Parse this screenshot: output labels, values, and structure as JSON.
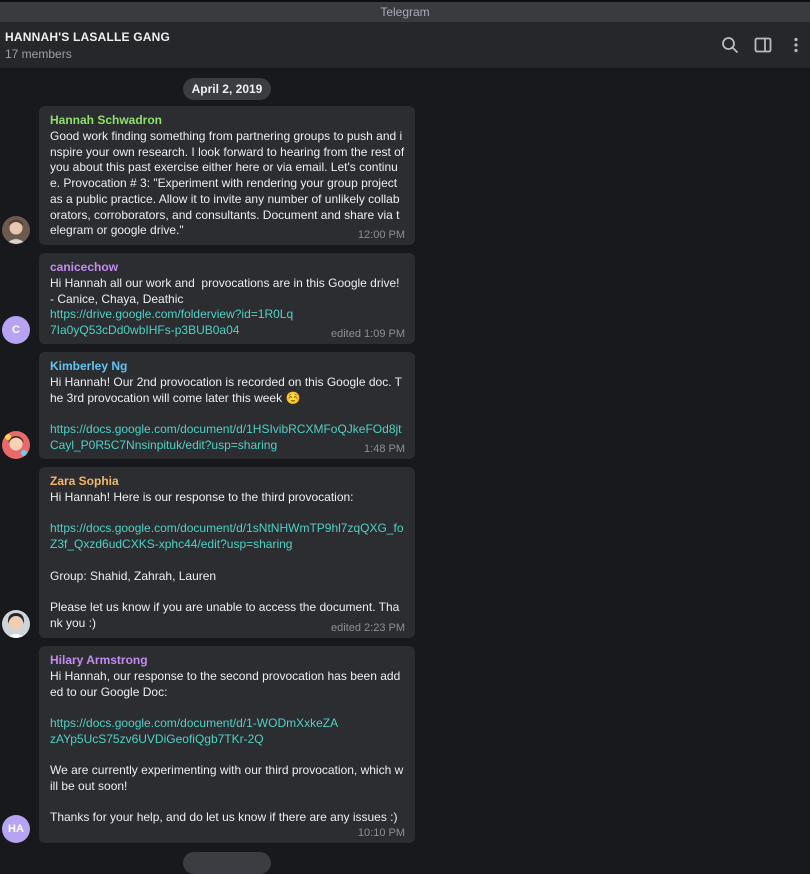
{
  "window": {
    "title": "Telegram"
  },
  "header": {
    "group_name": "HANNAH'S LASALLE GANG",
    "members": "17 members",
    "icons": [
      "search-icon",
      "sidebar-toggle-icon",
      "more-vertical-icon"
    ]
  },
  "chat": {
    "date_label": "April 2, 2019",
    "messages": [
      {
        "sender": "Hannah Schwadron",
        "sender_color": "#8fe06b",
        "text": "Good work finding something from partnering groups to push and inspire your own research. I look forward to hearing from the rest of you about this past exercise either here or via email. Let's continue. Provocation # 3: \"Experiment with rendering your group project as a public practice. Allow it to invite any number of unlikely collaborators, corroborators, and consultants. Document and share via telegram or google drive.\"",
        "time": "12:00 PM",
        "avatar": "photo"
      },
      {
        "sender": "canicechow",
        "sender_color": "#c38cf0",
        "text_before": "Hi Hannah all our work and  provocations are in this Google drive!\n- Canice, Chaya, Deathic\n",
        "link": "https://drive.google.com/folderview?id=1R0Lq7Ia0yQ53cDd0wbIHFs-p3BUB0a04",
        "time": "edited 1:09 PM",
        "avatar": "C",
        "avatar_color": "#b6a4f2"
      },
      {
        "sender": "Kimberley Ng",
        "sender_color": "#62c3f0",
        "text_before": "Hi Hannah! Our 2nd provocation is recorded on this Google doc. The 3rd provocation will come later this week ☺️\n\n",
        "link": "https://docs.google.com/document/d/1HSIvibRCXMFoQJkeFOd8jtCayl_P0R5C7Nnsinpituk/edit?usp=sharing",
        "time": "1:48 PM",
        "avatar": "photo"
      },
      {
        "sender": "Zara Sophia",
        "sender_color": "#f0b86b",
        "text_before": "Hi Hannah! Here is our response to the third provocation:\n\n",
        "link": "https://docs.google.com/document/d/1sNtNHWmTP9hl7zqQXG_foZ3f_Qxzd6udCXKS-xphc44/edit?usp=sharing",
        "text_after": "\n\nGroup: Shahid, Zahrah, Lauren\n\nPlease let us know if you are unable to access the document. Thank you :)",
        "time": "edited 2:23 PM",
        "avatar": "photo"
      },
      {
        "sender": "Hilary Armstrong",
        "sender_color": "#c38cf0",
        "text_before": "Hi Hannah, our response to the second provocation has been added to our Google Doc:\n\n",
        "link": "https://docs.google.com/document/d/1-WODmXxkeZAzAYp5UcS75zv6UVDiGeofiQgb7TKr-2Q",
        "text_after": "\n\nWe are currently experimenting with our third provocation, which will be out soon!\n\nThanks for your help, and do let us know if there are any issues :)",
        "time": "10:10 PM",
        "avatar": "HA",
        "avatar_color": "#b6a4f2"
      }
    ]
  }
}
